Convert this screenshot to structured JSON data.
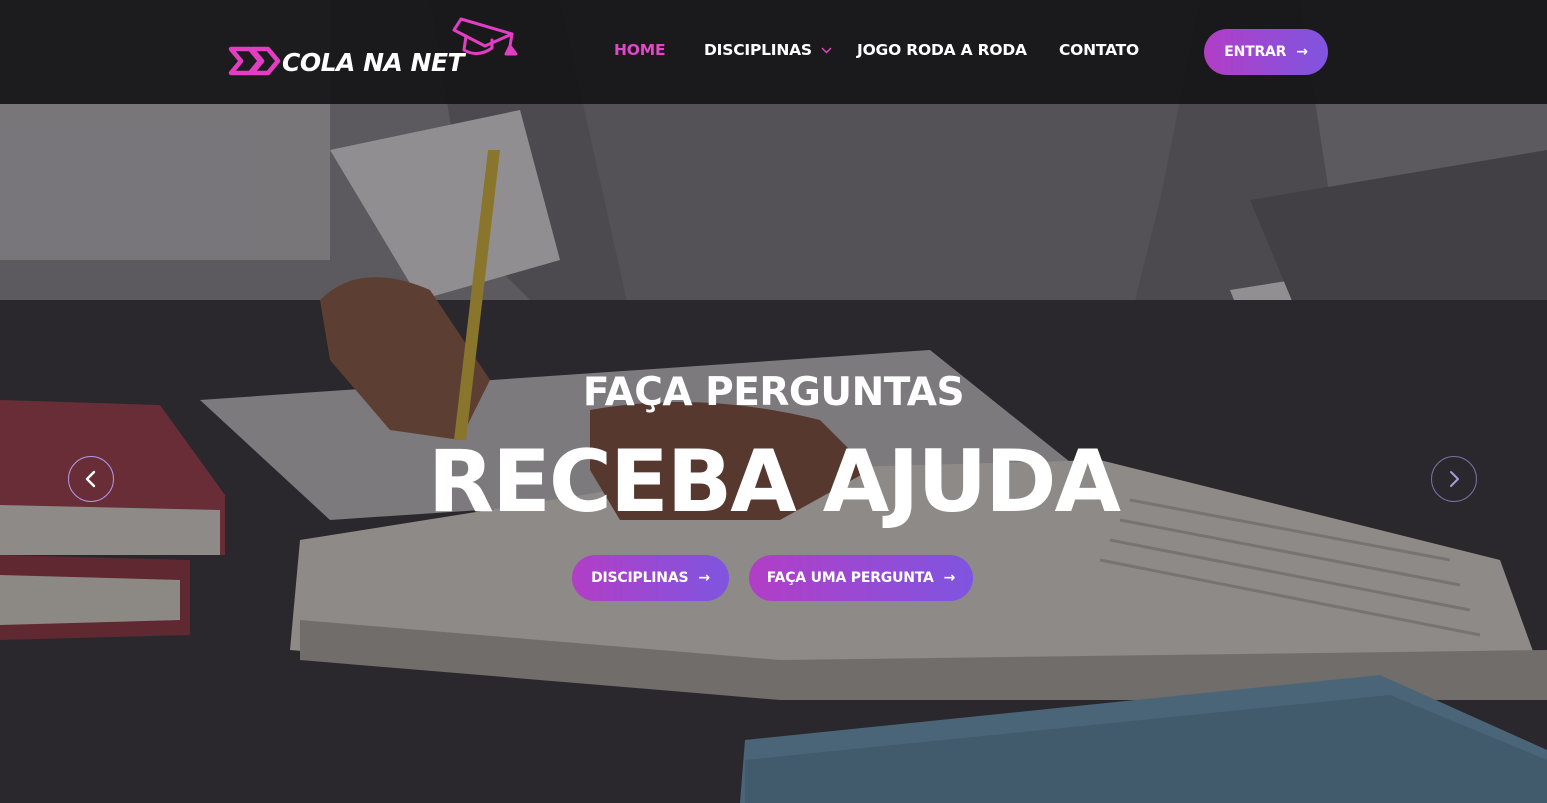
{
  "brand": {
    "name": "COLA NA NET",
    "accent_pink": "#e23ec4",
    "gradient_start": "#b23ec6",
    "gradient_end": "#7f55e0",
    "logo_icons": [
      "double-chevron-icon",
      "graduation-cap-icon"
    ]
  },
  "nav": {
    "items": [
      {
        "label": "HOME",
        "active": true
      },
      {
        "label": "DISCIPLINAS",
        "active": false,
        "has_dropdown": true
      },
      {
        "label": "JOGO RODA A RODA",
        "active": false
      },
      {
        "label": "CONTATO",
        "active": false
      }
    ],
    "active_color": "#e048c8"
  },
  "header": {
    "login_label": "ENTRAR",
    "login_icon": "arrow-right-icon"
  },
  "hero": {
    "subtitle": "FAÇA PERGUNTAS",
    "title": "RECEBA AJUDA",
    "buttons": [
      {
        "label": "DISCIPLINAS",
        "icon": "arrow-right-icon"
      },
      {
        "label": "FAÇA UMA PERGUNTA",
        "icon": "arrow-right-icon"
      }
    ],
    "carousel": {
      "prev_icon": "chevron-left-icon",
      "next_icon": "chevron-right-icon"
    }
  }
}
